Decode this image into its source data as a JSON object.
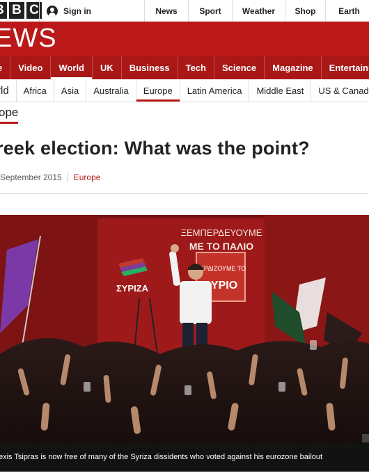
{
  "topbar": {
    "logo_letters": [
      "B",
      "B",
      "C"
    ],
    "signin_label": "Sign in",
    "nav": [
      {
        "label": "News",
        "width": 62
      },
      {
        "label": "Sport",
        "width": 62
      },
      {
        "label": "Weather",
        "width": 75
      },
      {
        "label": "Shop",
        "width": 57
      },
      {
        "label": "Earth",
        "width": 67
      }
    ]
  },
  "header": {
    "title": "EWS"
  },
  "main_nav": [
    {
      "label": "e",
      "active": false
    },
    {
      "label": "Video",
      "active": false
    },
    {
      "label": "World",
      "active": true
    },
    {
      "label": "UK",
      "active": false
    },
    {
      "label": "Business",
      "active": false
    },
    {
      "label": "Tech",
      "active": false
    },
    {
      "label": "Science",
      "active": false
    },
    {
      "label": "Magazine",
      "active": false
    },
    {
      "label": "Entertainment &",
      "active": false
    }
  ],
  "sub_nav": [
    {
      "label": "rld",
      "active": false,
      "section": true
    },
    {
      "label": "Africa",
      "active": false
    },
    {
      "label": "Asia",
      "active": false
    },
    {
      "label": "Australia",
      "active": false
    },
    {
      "label": "Europe",
      "active": true
    },
    {
      "label": "Latin America",
      "active": false
    },
    {
      "label": "Middle East",
      "active": false
    },
    {
      "label": "US & Canad",
      "active": false
    }
  ],
  "section_label": "ope",
  "article": {
    "headline": "reek election: What was the point?",
    "date": "September 2015",
    "category": "Europe",
    "caption": "exis Tsipras is now free of many of the Syriza dissidents who voted against his eurozone bailout"
  },
  "photo": {
    "banner_line1": "ΞΕΜΠΕΡΔΕΥΟΥΜΕ",
    "banner_line2": "ΜΕ ΤΟ ΠΑΛΙΟ",
    "sign_line1": "ΚΕΡΔΙΖΟΥΜΕ ΤΟ",
    "sign_line2": "ΑΥΡΙΟ",
    "party_name": "ΣΥΡΙΖΑ"
  },
  "colors": {
    "brand_red": "#bb1919",
    "nav_red": "#a91717",
    "stage_red": "#9e1a1a"
  }
}
